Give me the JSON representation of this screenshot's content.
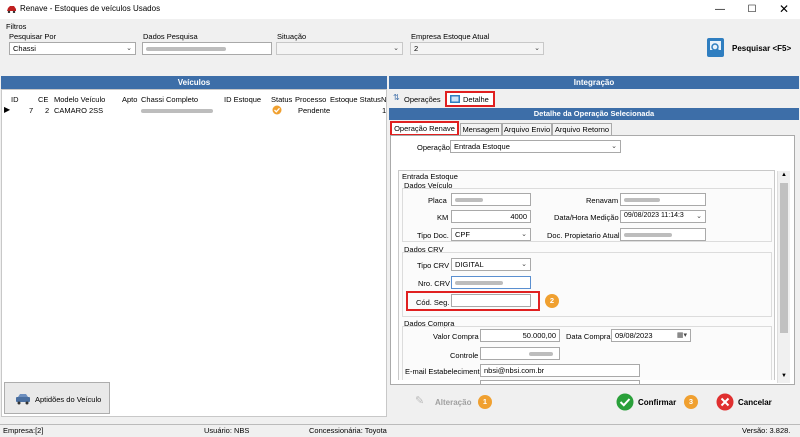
{
  "window": {
    "title": "Renave - Estoques de veículos Usados"
  },
  "filters": {
    "group_label": "Filtros",
    "search_by": {
      "label": "Pesquisar Por",
      "value": "Chassi"
    },
    "search_data": {
      "label": "Dados Pesquisa"
    },
    "situation": {
      "label": "Situação",
      "value": ""
    },
    "company": {
      "label": "Empresa Estoque Atual",
      "value": "2"
    },
    "search_button": "Pesquisar <F5>"
  },
  "vehicles": {
    "header": "Veículos",
    "columns": [
      "ID",
      "CE",
      "Modelo Veículo",
      "Apto",
      "Chassi Completo",
      "ID Estoque",
      "Status",
      "Processo",
      "Estoque Status",
      "N"
    ],
    "rows": [
      {
        "id": "7",
        "ce": "2",
        "model": "CAMARO 2SS",
        "status_icon": "check-circle-icon",
        "processo": "Pendente",
        "n": "1"
      }
    ],
    "aptitudes_button": "Aptidões do Veículo"
  },
  "integration": {
    "header": "Integração",
    "tabs": [
      {
        "label": "Operações",
        "icon": "flow-icon"
      },
      {
        "label": "Detalhe",
        "icon": "detail-icon"
      }
    ],
    "detail_header": "Detalhe da Operação Selecionada",
    "subtabs": [
      "Operação Renave",
      "Mensagem",
      "Arquivo Envio",
      "Arquivo Retorno"
    ],
    "operacao": {
      "label": "Operação",
      "value": "Entrada Estoque"
    },
    "entrada_estoque": {
      "title": "Entrada Estoque",
      "dados_veiculo": {
        "title": "Dados Veículo",
        "placa_label": "Placa",
        "renavam_label": "Renavam",
        "km_label": "KM",
        "km_value": "4000",
        "data_hora_label": "Data/Hora Medição",
        "data_hora_value": "09/08/2023 11:14:3",
        "tipo_doc_label": "Tipo Doc.",
        "tipo_doc_value": "CPF",
        "doc_prop_label": "Doc. Propietario Atual"
      },
      "dados_crv": {
        "title": "Dados CRV",
        "tipo_crv_label": "Tipo CRV",
        "tipo_crv_value": "DIGITAL",
        "nro_crv_label": "Nro. CRV",
        "cod_seg_label": "Cód. Seg.",
        "cod_seg_value": "",
        "badge": "2"
      },
      "dados_compra": {
        "title": "Dados Compra",
        "valor_label": "Valor Compra",
        "valor_value": "50.000,00",
        "data_label": "Data Compra",
        "data_value": "09/08/2023",
        "controle_label": "Controle",
        "email_label": "E-mail Estabelecimento",
        "email_value": "nbsi@nbsi.com.br"
      }
    },
    "actions": {
      "alteracao": "Alteração",
      "alteracao_badge": "1",
      "confirmar": "Confirmar",
      "confirmar_badge": "3",
      "cancelar": "Cancelar"
    }
  },
  "statusbar": {
    "empresa": "Empresa:[2]",
    "usuario": "Usuário: NBS",
    "concessionaria": "Concessionária: Toyota",
    "versao": "Versão: 3.828."
  },
  "colors": {
    "accent_blue": "#3d6ea8",
    "highlight_red": "#e02020",
    "badge_orange": "#f0a030",
    "confirm_green": "#2aa03a",
    "cancel_red": "#e03030"
  }
}
